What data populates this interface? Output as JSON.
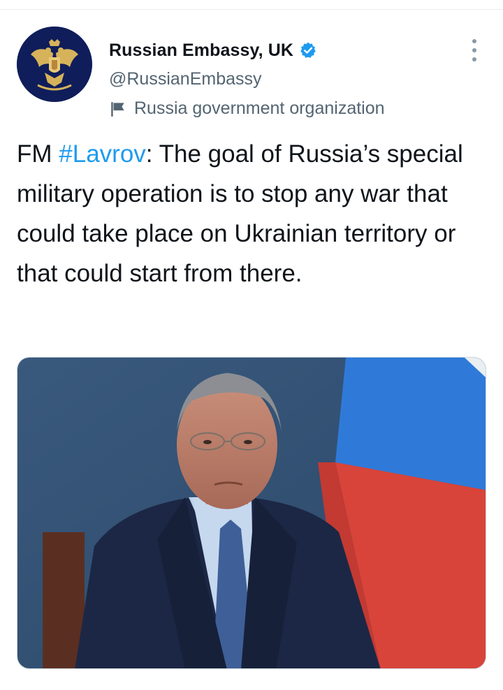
{
  "tweet": {
    "author": {
      "display_name": "Russian Embassy, UK",
      "handle": "@RussianEmbassy",
      "verified": true,
      "avatar_icon": "coat-of-arms-icon"
    },
    "affiliation_label": "Russia government organization",
    "affiliation_icon": "flag-icon",
    "text_prefix": "FM ",
    "hashtag": "#Lavrov",
    "text_suffix": ": The goal of Russia’s special military operation is to stop any war that could take place on Ukrainian territory or that could start from there.",
    "media": {
      "type": "photo"
    }
  },
  "icons": {
    "more": "more-options-icon",
    "verified": "verified-badge-icon"
  },
  "colors": {
    "link": "#1d9bf0",
    "secondary_text": "#536471",
    "avatar_background": "#0f1d5a",
    "emblem_gold": "#d6b25a"
  }
}
